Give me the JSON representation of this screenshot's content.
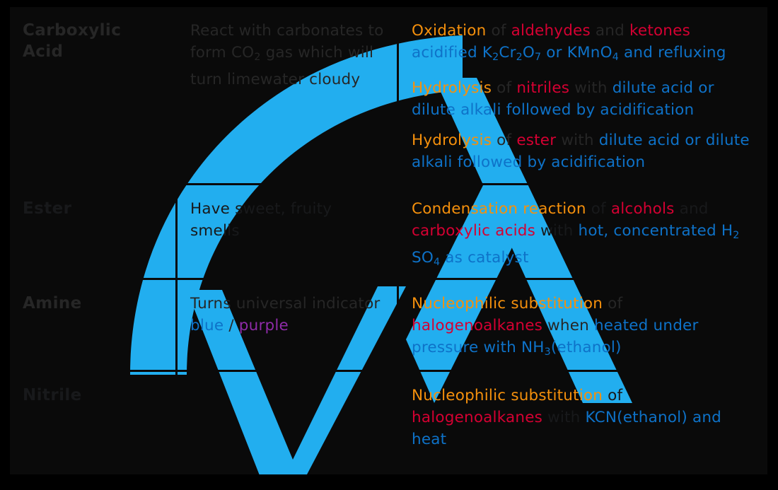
{
  "table": {
    "rows": [
      {
        "tone": "dark",
        "compound": "Carboxylic Acid",
        "test": "React with carbonates to form CO2 gas which will turn limewater cloudy",
        "test_parts": [
          {
            "t": "React with carbonates to form CO",
            "c": "plain"
          },
          {
            "t": "2",
            "c": "plain",
            "sub": true
          },
          {
            "t": " gas which will turn limewater cloudy",
            "c": "plain"
          }
        ],
        "preparation": [
          {
            "id": "oxidation-aldehydes-ketones",
            "parts": [
              {
                "t": "Oxidation",
                "c": "orange"
              },
              {
                "t": " of ",
                "c": "plain"
              },
              {
                "t": "aldehydes",
                "c": "red"
              },
              {
                "t": " and ",
                "c": "plain"
              },
              {
                "t": "ketones",
                "c": "red"
              },
              {
                "t": " ",
                "c": "plain"
              },
              {
                "t": "acidified K",
                "c": "blue"
              },
              {
                "t": "2",
                "c": "blue",
                "sub": true
              },
              {
                "t": "Cr",
                "c": "blue"
              },
              {
                "t": "2",
                "c": "blue",
                "sub": true
              },
              {
                "t": "O",
                "c": "blue"
              },
              {
                "t": "7",
                "c": "blue",
                "sub": true
              },
              {
                "t": " or KMnO",
                "c": "blue"
              },
              {
                "t": "4",
                "c": "blue",
                "sub": true
              },
              {
                "t": " and refluxing",
                "c": "blue"
              }
            ]
          },
          {
            "id": "hydrolysis-nitriles",
            "parts": [
              {
                "t": "Hydrolysis",
                "c": "orange"
              },
              {
                "t": " of ",
                "c": "plain"
              },
              {
                "t": "nitriles",
                "c": "red"
              },
              {
                "t": " with ",
                "c": "plain"
              },
              {
                "t": "dilute acid  or dilute alkali followed by  acidification",
                "c": "blue"
              }
            ]
          },
          {
            "id": "hydrolysis-ester",
            "parts": [
              {
                "t": "Hydrolysis",
                "c": "orange"
              },
              {
                "t": " of ",
                "c": "plain"
              },
              {
                "t": "ester",
                "c": "red"
              },
              {
                "t": " with ",
                "c": "plain"
              },
              {
                "t": " dilute acid or dilute alkali followed by acidification",
                "c": "blue"
              }
            ]
          }
        ]
      },
      {
        "tone": "light",
        "compound": "Ester",
        "test": "Have sweet, fruity smells",
        "test_parts": [
          {
            "t": "Have sweet, fruity smells",
            "c": "plain"
          }
        ],
        "preparation": [
          {
            "id": "condensation-alcohol-carboxylic-acid",
            "parts": [
              {
                "t": "Condensation reaction",
                "c": "orange"
              },
              {
                "t": " of ",
                "c": "plain"
              },
              {
                "t": "alcohols",
                "c": "red"
              },
              {
                "t": " and ",
                "c": "plain"
              },
              {
                "t": "carboxylic acids",
                "c": "red"
              },
              {
                "t": " with ",
                "c": "plain"
              },
              {
                "t": "hot, concentrated H",
                "c": "blue"
              },
              {
                "t": "2",
                "c": "blue",
                "sub": true
              },
              {
                "t": " SO",
                "c": "blue"
              },
              {
                "t": "4",
                "c": "blue",
                "sub": true
              },
              {
                "t": " as catalyst",
                "c": "blue"
              }
            ]
          }
        ]
      },
      {
        "tone": "dark",
        "compound": "Amine",
        "test": "Turns universal indicator blue / purple",
        "test_parts": [
          {
            "t": "Turns universal indicator ",
            "c": "plain"
          },
          {
            "t": "blue",
            "c": "blue"
          },
          {
            "t": " / ",
            "c": "plain"
          },
          {
            "t": "purple",
            "c": "purple"
          }
        ],
        "preparation": [
          {
            "id": "nucleophilic-substitution-ammonia",
            "parts": [
              {
                "t": "Nucleophilic substitution",
                "c": "orange"
              },
              {
                "t": " of ",
                "c": "plain"
              },
              {
                "t": "halogenoalkanes",
                "c": "red"
              },
              {
                "t": " when ",
                "c": "plain"
              },
              {
                "t": "heated under pressure with NH",
                "c": "blue"
              },
              {
                "t": "3",
                "c": "blue",
                "sub": true
              },
              {
                "t": "(ethanol)",
                "c": "blue"
              }
            ]
          }
        ]
      },
      {
        "tone": "light",
        "compound": "Nitrile",
        "test": "",
        "test_parts": [],
        "preparation": [
          {
            "id": "nucleophilic-substitution-cyanide",
            "parts": [
              {
                "t": "Nucleophilic substitution",
                "c": "orange"
              },
              {
                "t": " of ",
                "c": "plain"
              },
              {
                "t": "halogenoalkanes",
                "c": "red"
              },
              {
                "t": " with ",
                "c": "plain"
              },
              {
                "t": "KCN(ethanol) and heat",
                "c": "blue"
              }
            ]
          }
        ]
      }
    ]
  },
  "colors": {
    "reaction_type": "#f5900c",
    "compound": "#d50032",
    "reagent": "#0e72c8",
    "indicator_purple": "#8e2ba8",
    "watermark": "#22aeef",
    "dark_row_bg": "#0a0a0a",
    "light_row_bg": "#f7f7f7"
  },
  "watermark": {
    "name": "save-my-exams-logo"
  }
}
